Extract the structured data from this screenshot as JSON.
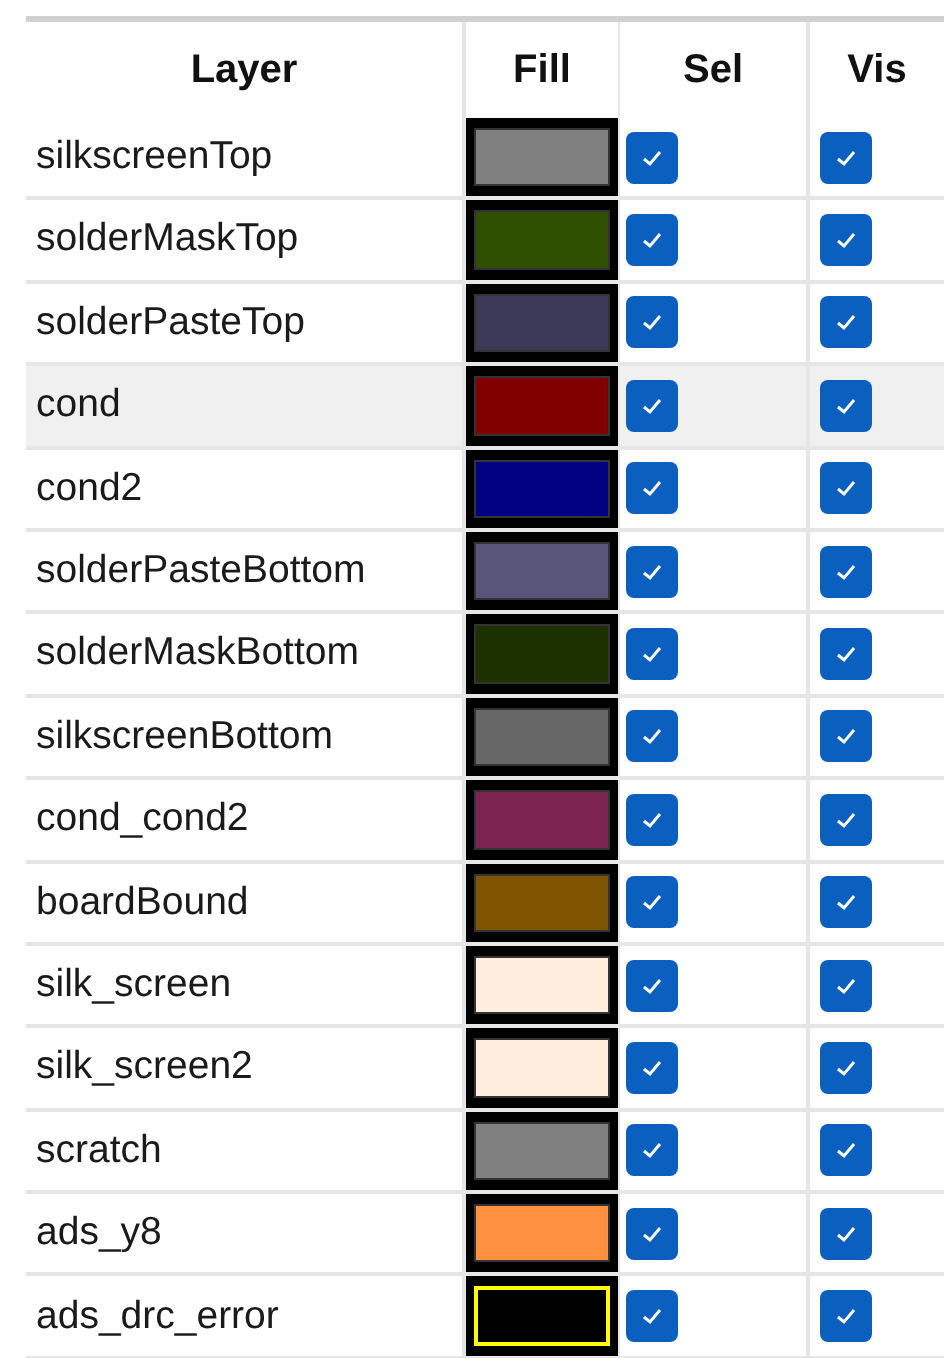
{
  "columns": [
    "Layer",
    "Fill",
    "Sel",
    "Vis"
  ],
  "layers": [
    {
      "name": "silkscreenTop",
      "color": "#808080",
      "sel": true,
      "vis": true,
      "selected": false
    },
    {
      "name": "solderMaskTop",
      "color": "#2e5000",
      "sel": true,
      "vis": true,
      "selected": false
    },
    {
      "name": "solderPasteTop",
      "color": "#3c3a58",
      "sel": true,
      "vis": true,
      "selected": false
    },
    {
      "name": "cond",
      "color": "#800000",
      "sel": true,
      "vis": true,
      "selected": true
    },
    {
      "name": "cond2",
      "color": "#000080",
      "sel": true,
      "vis": true,
      "selected": false
    },
    {
      "name": "solderPasteBottom",
      "color": "#58547a",
      "sel": true,
      "vis": true,
      "selected": false
    },
    {
      "name": "solderMaskBottom",
      "color": "#1c3000",
      "sel": true,
      "vis": true,
      "selected": false
    },
    {
      "name": "silkscreenBottom",
      "color": "#666666",
      "sel": true,
      "vis": true,
      "selected": false
    },
    {
      "name": "cond_cond2",
      "color": "#7e2450",
      "sel": true,
      "vis": true,
      "selected": false
    },
    {
      "name": "boardBound",
      "color": "#7e5400",
      "sel": true,
      "vis": true,
      "selected": false
    },
    {
      "name": "silk_screen",
      "color": "#ffeedd",
      "sel": true,
      "vis": true,
      "selected": false
    },
    {
      "name": "silk_screen2",
      "color": "#ffeedd",
      "sel": true,
      "vis": true,
      "selected": false
    },
    {
      "name": "scratch",
      "color": "#808080",
      "sel": true,
      "vis": true,
      "selected": false
    },
    {
      "name": "ads_y8",
      "color": "#ff9040",
      "sel": true,
      "vis": true,
      "selected": false
    },
    {
      "name": "ads_drc_error",
      "color": "#000000",
      "kind": "outlined",
      "sel": true,
      "vis": true,
      "selected": false
    }
  ]
}
